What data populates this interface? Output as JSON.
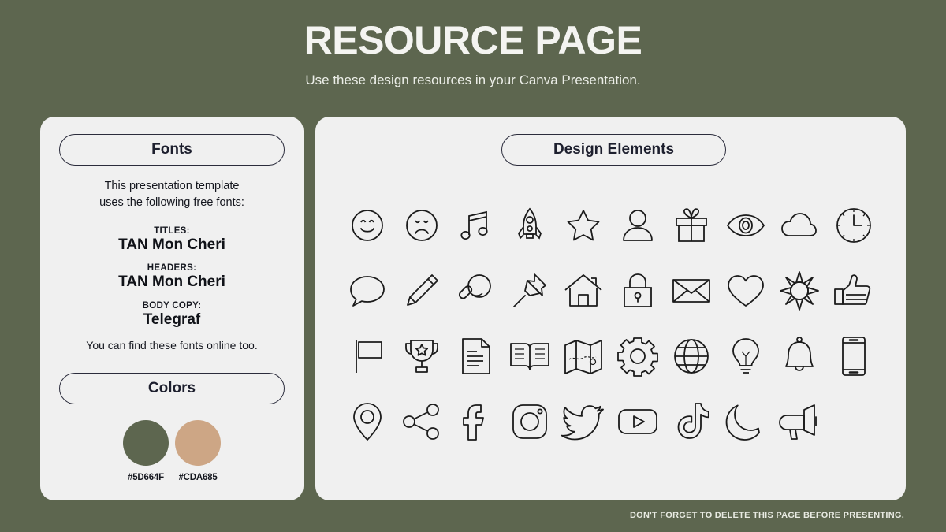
{
  "header": {
    "title": "RESOURCE PAGE",
    "subtitle": "Use these design resources in your Canva Presentation."
  },
  "fonts_panel": {
    "heading": "Fonts",
    "intro": "This presentation template\nuses the following free fonts:",
    "entries": [
      {
        "label": "TITLES:",
        "value": "TAN Mon Cheri"
      },
      {
        "label": "HEADERS:",
        "value": "TAN Mon Cheri"
      },
      {
        "label": "BODY COPY:",
        "value": "Telegraf"
      }
    ],
    "outro": "You can find these fonts online too."
  },
  "colors_panel": {
    "heading": "Colors",
    "swatches": [
      {
        "hex": "#5D664F",
        "label": "#5D664F"
      },
      {
        "hex": "#CDA685",
        "label": "#CDA685"
      }
    ]
  },
  "elements_panel": {
    "heading": "Design Elements",
    "icons": [
      "smiley-face-icon",
      "sad-face-icon",
      "music-note-icon",
      "rocket-icon",
      "star-icon",
      "person-icon",
      "gift-icon",
      "eye-icon",
      "cloud-icon",
      "clock-icon",
      "speech-bubble-icon",
      "pencil-icon",
      "magnifier-icon",
      "pushpin-icon",
      "house-icon",
      "lock-icon",
      "envelope-icon",
      "heart-icon",
      "sun-icon",
      "thumbs-up-icon",
      "flag-icon",
      "trophy-icon",
      "document-icon",
      "book-icon",
      "map-icon",
      "gear-icon",
      "globe-icon",
      "lightbulb-icon",
      "bell-icon",
      "phone-icon",
      "location-pin-icon",
      "share-icon",
      "facebook-icon",
      "instagram-icon",
      "twitter-icon",
      "youtube-icon",
      "tiktok-icon",
      "moon-icon",
      "megaphone-icon"
    ]
  },
  "footer": {
    "note": "DON'T FORGET TO DELETE THIS PAGE BEFORE PRESENTING."
  },
  "theme": {
    "background": "#5D664F",
    "panel": "#F0F0F0",
    "outline": "#2B2C3C",
    "title_text": "#F4F4F1"
  }
}
